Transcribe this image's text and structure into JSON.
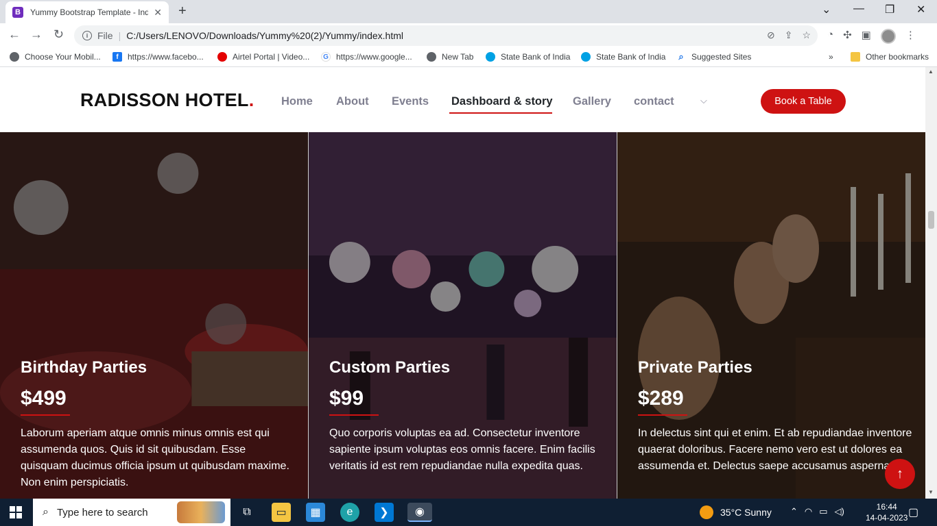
{
  "browser": {
    "tab_title": "Yummy Bootstrap Template - Index",
    "tab_icon_letter": "B",
    "omnibox_prefix": "File",
    "url": "C:/Users/LENOVO/Downloads/Yummy%20(2)/Yummy/index.html",
    "bookmarks": [
      {
        "label": "Choose Your Mobil...",
        "icon": "globe-icon"
      },
      {
        "label": "https://www.facebo...",
        "icon": "facebook-icon"
      },
      {
        "label": "Airtel Portal | Video...",
        "icon": "airtel-icon"
      },
      {
        "label": "https://www.google...",
        "icon": "google-icon"
      },
      {
        "label": "New Tab",
        "icon": "globe-icon"
      },
      {
        "label": "State Bank of India",
        "icon": "sbi-icon"
      },
      {
        "label": "State Bank of India",
        "icon": "sbi-icon"
      },
      {
        "label": "Suggested Sites",
        "icon": "search-icon"
      }
    ],
    "other_bookmarks": "Other bookmarks"
  },
  "site": {
    "logo": "RADISSON HOTEL",
    "logo_dot": ".",
    "nav": [
      "Home",
      "About",
      "Events",
      "Dashboard & story",
      "Gallery",
      "contact"
    ],
    "active_nav": "Dashboard & story",
    "cta": "Book a Table",
    "accent": "#ce1212"
  },
  "events": [
    {
      "title": "Birthday Parties",
      "price": "$499",
      "desc": "Laborum aperiam atque omnis minus omnis est qui assumenda quos. Quis id sit quibusdam. Esse quisquam ducimus officia ipsum ut quibusdam maxime. Non enim perspiciatis."
    },
    {
      "title": "Custom Parties",
      "price": "$99",
      "desc": "Quo corporis voluptas ea ad. Consectetur inventore sapiente ipsum voluptas eos omnis facere. Enim facilis veritatis id est rem repudiandae nulla expedita quas."
    },
    {
      "title": "Private Parties",
      "price": "$289",
      "desc": "In delectus sint qui et enim. Et ab repudiandae inventore quaerat doloribus. Facere nemo vero est ut dolores ea assumenda et. Delectus saepe accusamus aspernatur."
    }
  ],
  "taskbar": {
    "search_placeholder": "Type here to search",
    "weather": "35°C  Sunny",
    "time": "16:44",
    "date": "14-04-2023"
  }
}
